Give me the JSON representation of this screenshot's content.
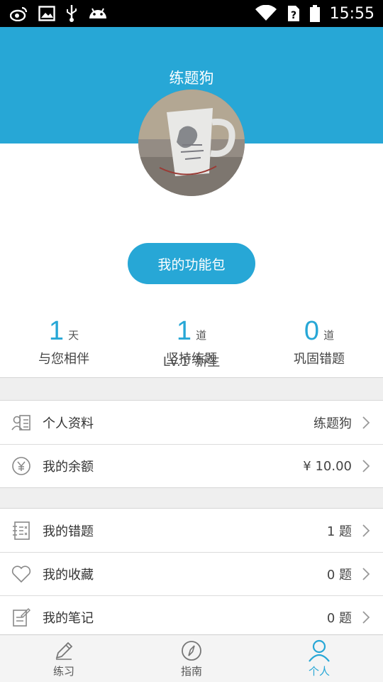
{
  "statusbar": {
    "time": "15:55",
    "left_icons": [
      "weibo-icon",
      "image-icon",
      "usb-icon",
      "android-icon"
    ],
    "right_icons": [
      "wifi-icon",
      "sim-unknown-icon",
      "battery-icon"
    ]
  },
  "header": {
    "title": "练题狗"
  },
  "profile": {
    "level": "Lv.1",
    "rank": "新生",
    "package_button": "我的功能包"
  },
  "stats": [
    {
      "value": "1",
      "unit": "天",
      "label": "与您相伴"
    },
    {
      "value": "1",
      "unit": "道",
      "label": "坚持练题"
    },
    {
      "value": "0",
      "unit": "道",
      "label": "巩固错题"
    }
  ],
  "account": {
    "items": [
      {
        "icon": "profile-card-icon",
        "label": "个人资料",
        "value": "练题狗"
      },
      {
        "icon": "yuan-coin-icon",
        "label": "我的余额",
        "value": "¥ 10.00"
      }
    ]
  },
  "records": {
    "items": [
      {
        "icon": "wrong-questions-icon",
        "label": "我的错题",
        "value": "1 题"
      },
      {
        "icon": "heart-icon",
        "label": "我的收藏",
        "value": "0 题"
      },
      {
        "icon": "notes-icon",
        "label": "我的笔记",
        "value": "0 题"
      }
    ]
  },
  "tabbar": {
    "tabs": [
      {
        "icon": "pencil-icon",
        "label": "练习",
        "active": false
      },
      {
        "icon": "compass-icon",
        "label": "指南",
        "active": false
      },
      {
        "icon": "person-icon",
        "label": "个人",
        "active": true
      }
    ]
  },
  "colors": {
    "accent": "#27a7d6",
    "statusbar": "#000000",
    "background": "#efefef"
  }
}
